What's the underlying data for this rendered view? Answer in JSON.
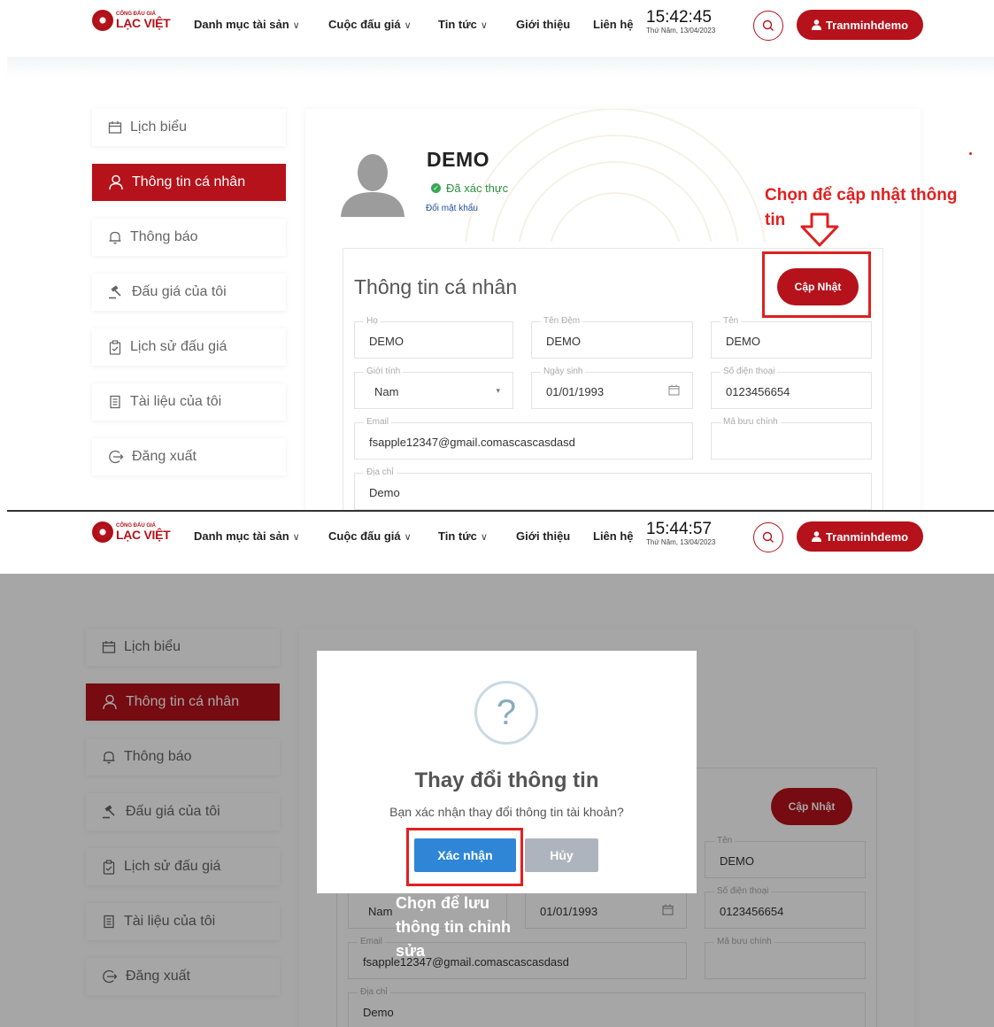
{
  "brand": {
    "small": "CỔNG ĐẤU GIÁ",
    "big": "LẠC VIỆT"
  },
  "nav": {
    "catalog": "Danh mục tài sản",
    "auctions": "Cuộc đấu giá",
    "news": "Tin tức",
    "about": "Giới thiệu",
    "contact": "Liên hệ"
  },
  "user_button": "Tranminhdemo",
  "panel1": {
    "time": "15:42:45",
    "date": "Thứ Năm, 13/04/2023"
  },
  "panel2": {
    "time": "15:44:57",
    "date": "Thứ Năm, 13/04/2023"
  },
  "sidebar": [
    {
      "label": "Lịch biểu",
      "icon": "calendar-icon"
    },
    {
      "label": "Thông tin cá nhân",
      "icon": "user-icon"
    },
    {
      "label": "Thông báo",
      "icon": "bell-icon"
    },
    {
      "label": "Đấu giá của tôi",
      "icon": "gavel-icon"
    },
    {
      "label": "Lịch sử đấu giá",
      "icon": "clipboard-icon"
    },
    {
      "label": "Tài liệu của tôi",
      "icon": "document-icon"
    },
    {
      "label": "Đăng xuất",
      "icon": "logout-icon"
    }
  ],
  "profile": {
    "name": "DEMO",
    "verified": "Đã xác thực",
    "change_password": "Đổi mật khẩu"
  },
  "form": {
    "title": "Thông tin cá nhân",
    "update_button": "Cập Nhật",
    "fields": {
      "ho": {
        "label": "Họ",
        "value": "DEMO"
      },
      "ten_dem": {
        "label": "Tên Đệm",
        "value": "DEMO"
      },
      "ten": {
        "label": "Tên",
        "value": "DEMO"
      },
      "gioi_tinh": {
        "label": "Giới tính",
        "value": "Nam"
      },
      "ngay_sinh": {
        "label": "Ngày sinh",
        "value": "01/01/1993"
      },
      "sdt": {
        "label": "Số điện thoại",
        "value": "0123456654"
      },
      "email": {
        "label": "Email",
        "value": "fsapple12347@gmail.comascascasdasd"
      },
      "ma_buu_chinh": {
        "label": "Mã bưu chính",
        "value": ""
      },
      "dia_chi": {
        "label": "Địa chỉ",
        "value": "Demo"
      }
    }
  },
  "annotations": {
    "update_hint": "Chọn để cập nhật thông tin",
    "save_hint": "Chọn để lưu thông tin chỉnh sửa"
  },
  "dialog": {
    "icon_glyph": "?",
    "title": "Thay đổi thông tin",
    "message": "Bạn xác nhận thay đổi thông tin tài khoản?",
    "confirm": "Xác nhận",
    "cancel": "Hủy"
  },
  "colors": {
    "brand_red": "#b5121b",
    "annotation_red": "#e02020",
    "confirm_blue": "#2f86d6",
    "verified_green": "#3aa757"
  }
}
